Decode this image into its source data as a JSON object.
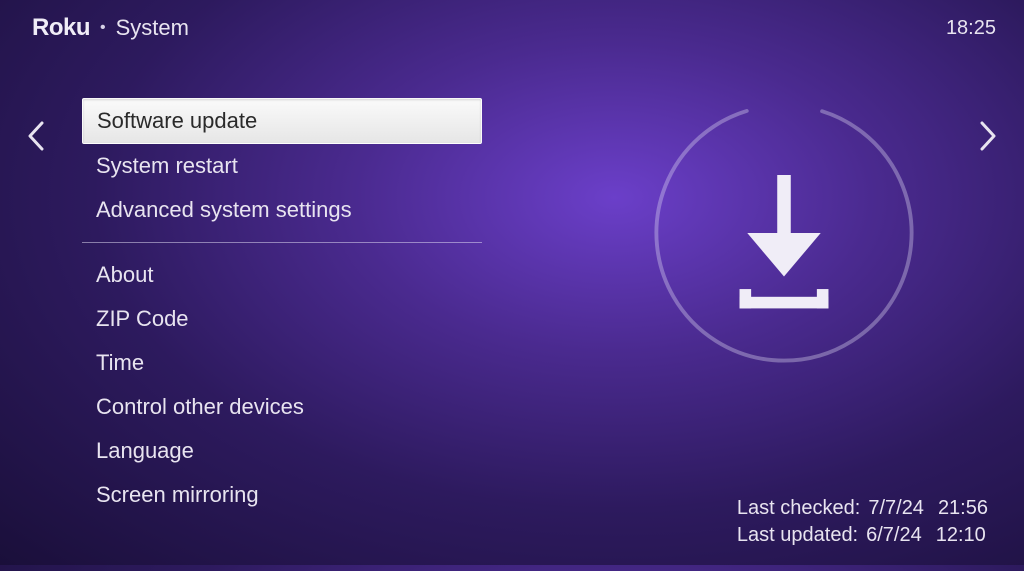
{
  "header": {
    "logo": "Roku",
    "title": "System",
    "clock": "18:25"
  },
  "menu": {
    "group1": [
      "Software update",
      "System restart",
      "Advanced system settings"
    ],
    "group2": [
      "About",
      "ZIP Code",
      "Time",
      "Control other devices",
      "Language",
      "Screen mirroring"
    ],
    "selected_index": 0
  },
  "detail": {
    "last_checked_label": "Last checked:",
    "last_checked_date": "7/7/24",
    "last_checked_time": "21:56",
    "last_updated_label": "Last updated:",
    "last_updated_date": "6/7/24",
    "last_updated_time": "12:10"
  }
}
